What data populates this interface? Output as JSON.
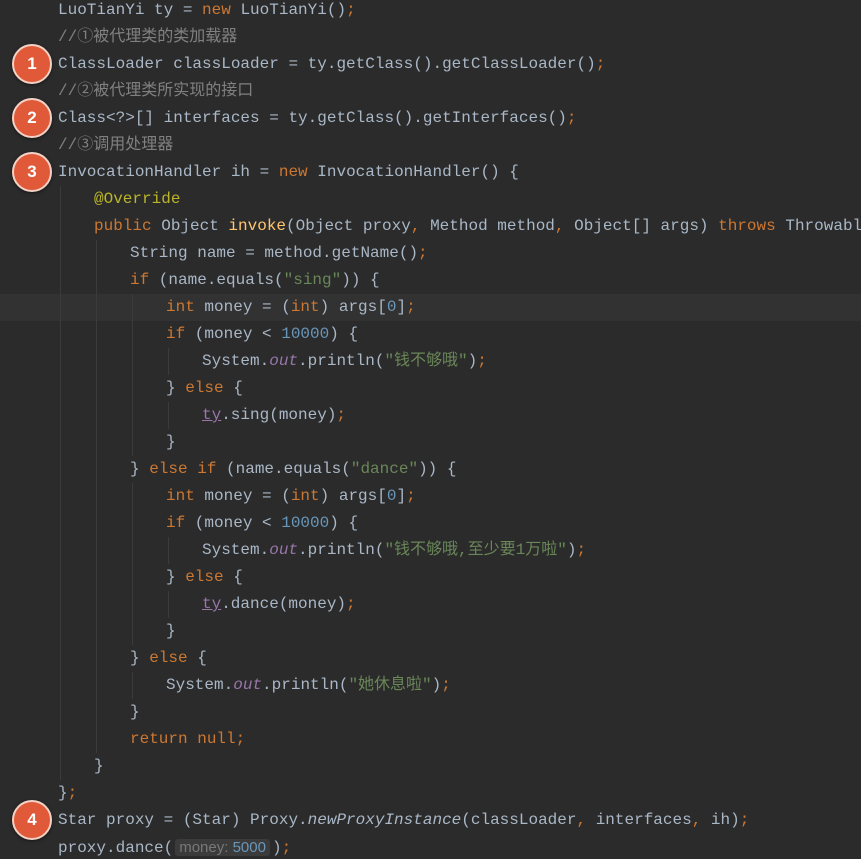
{
  "colors": {
    "background": "#2b2b2b",
    "current_line": "#323232",
    "default_text": "#a9b7c6",
    "keyword": "#cc7832",
    "string": "#6a8759",
    "number": "#6897bb",
    "comment": "#808080",
    "annotation": "#bbb529",
    "method_declaration": "#ffc66d",
    "field": "#9876aa",
    "badge": "#e05a3a"
  },
  "badges": [
    "1",
    "2",
    "3",
    "4"
  ],
  "lines": [
    [
      [
        "t",
        "LuoTianYi ty = "
      ],
      [
        "kw",
        "new"
      ],
      [
        "t",
        " LuoTianYi()"
      ],
      [
        "kw",
        ";"
      ]
    ],
    [
      [
        "cm",
        "//①被代理类的类加载器"
      ]
    ],
    [
      [
        "t",
        "ClassLoader classLoader = ty.getClass().getClassLoader()"
      ],
      [
        "kw",
        ";"
      ]
    ],
    [
      [
        "cm",
        "//②被代理类所实现的接口"
      ]
    ],
    [
      [
        "t",
        "Class<?>[] interfaces = ty.getClass().getInterfaces()"
      ],
      [
        "kw",
        ";"
      ]
    ],
    [
      [
        "cm",
        "//③调用处理器"
      ]
    ],
    [
      [
        "t",
        "InvocationHandler ih = "
      ],
      [
        "kw",
        "new"
      ],
      [
        "t",
        " InvocationHandler() {"
      ]
    ],
    [
      [
        "ann",
        "@Override"
      ]
    ],
    [
      [
        "kw",
        "public"
      ],
      [
        "t",
        " Object "
      ],
      [
        "fn",
        "invoke"
      ],
      [
        "t",
        "(Object proxy"
      ],
      [
        "kw",
        ","
      ],
      [
        "t",
        " Method method"
      ],
      [
        "kw",
        ","
      ],
      [
        "t",
        " Object[] args) "
      ],
      [
        "kw",
        "throws"
      ],
      [
        "t",
        " Throwable {"
      ]
    ],
    [
      [
        "t",
        "String name = method.getName()"
      ],
      [
        "kw",
        ";"
      ]
    ],
    [
      [
        "kw",
        "if"
      ],
      [
        "t",
        " (name.equals("
      ],
      [
        "str",
        "\"sing\""
      ],
      [
        "t",
        ")) {"
      ]
    ],
    [
      [
        "kw",
        "int"
      ],
      [
        "t",
        " money = ("
      ],
      [
        "kw",
        "int"
      ],
      [
        "t",
        ") args["
      ],
      [
        "num",
        "0"
      ],
      [
        "t",
        "]"
      ],
      [
        "kw",
        ";"
      ]
    ],
    [
      [
        "kw",
        "if"
      ],
      [
        "t",
        " (money < "
      ],
      [
        "num",
        "10000"
      ],
      [
        "t",
        ") {"
      ]
    ],
    [
      [
        "t",
        "System."
      ],
      [
        "sf",
        "out"
      ],
      [
        "t",
        ".println("
      ],
      [
        "str",
        "\"钱不够哦\""
      ],
      [
        "t",
        ")"
      ],
      [
        "kw",
        ";"
      ]
    ],
    [
      [
        "t",
        "} "
      ],
      [
        "kw",
        "else"
      ],
      [
        "t",
        " {"
      ]
    ],
    [
      [
        "fld",
        "ty"
      ],
      [
        "t",
        ".sing(money)"
      ],
      [
        "kw",
        ";"
      ]
    ],
    [
      [
        "t",
        "}"
      ]
    ],
    [
      [
        "t",
        "} "
      ],
      [
        "kw",
        "else if"
      ],
      [
        "t",
        " (name.equals("
      ],
      [
        "str",
        "\"dance\""
      ],
      [
        "t",
        ")) {"
      ]
    ],
    [
      [
        "kw",
        "int"
      ],
      [
        "t",
        " money = ("
      ],
      [
        "kw",
        "int"
      ],
      [
        "t",
        ") args["
      ],
      [
        "num",
        "0"
      ],
      [
        "t",
        "]"
      ],
      [
        "kw",
        ";"
      ]
    ],
    [
      [
        "kw",
        "if"
      ],
      [
        "t",
        " (money < "
      ],
      [
        "num",
        "10000"
      ],
      [
        "t",
        ") {"
      ]
    ],
    [
      [
        "t",
        "System."
      ],
      [
        "sf",
        "out"
      ],
      [
        "t",
        ".println("
      ],
      [
        "str",
        "\"钱不够哦,至少要1万啦\""
      ],
      [
        "t",
        ")"
      ],
      [
        "kw",
        ";"
      ]
    ],
    [
      [
        "t",
        "} "
      ],
      [
        "kw",
        "else"
      ],
      [
        "t",
        " {"
      ]
    ],
    [
      [
        "fld",
        "ty"
      ],
      [
        "t",
        ".dance(money)"
      ],
      [
        "kw",
        ";"
      ]
    ],
    [
      [
        "t",
        "}"
      ]
    ],
    [
      [
        "t",
        "} "
      ],
      [
        "kw",
        "else"
      ],
      [
        "t",
        " {"
      ]
    ],
    [
      [
        "t",
        "System."
      ],
      [
        "sf",
        "out"
      ],
      [
        "t",
        ".println("
      ],
      [
        "str",
        "\"她休息啦\""
      ],
      [
        "t",
        ")"
      ],
      [
        "kw",
        ";"
      ]
    ],
    [
      [
        "t",
        "}"
      ]
    ],
    [
      [
        "kw",
        "return null;"
      ]
    ],
    [
      [
        "t",
        "}"
      ]
    ],
    [
      [
        "t",
        "}"
      ],
      [
        "kw",
        ";"
      ]
    ],
    [
      [
        "t",
        "Star proxy = (Star) Proxy."
      ],
      [
        "stat",
        "newProxyInstance"
      ],
      [
        "t",
        "(classLoader"
      ],
      [
        "kw",
        ","
      ],
      [
        "t",
        " interfaces"
      ],
      [
        "kw",
        ","
      ],
      [
        "t",
        " ih)"
      ],
      [
        "kw",
        ";"
      ]
    ],
    [
      [
        "t",
        "proxy.dance("
      ],
      [
        "hint",
        "money:",
        "5000"
      ],
      [
        "t",
        ")"
      ],
      [
        "kw",
        ";"
      ]
    ]
  ]
}
